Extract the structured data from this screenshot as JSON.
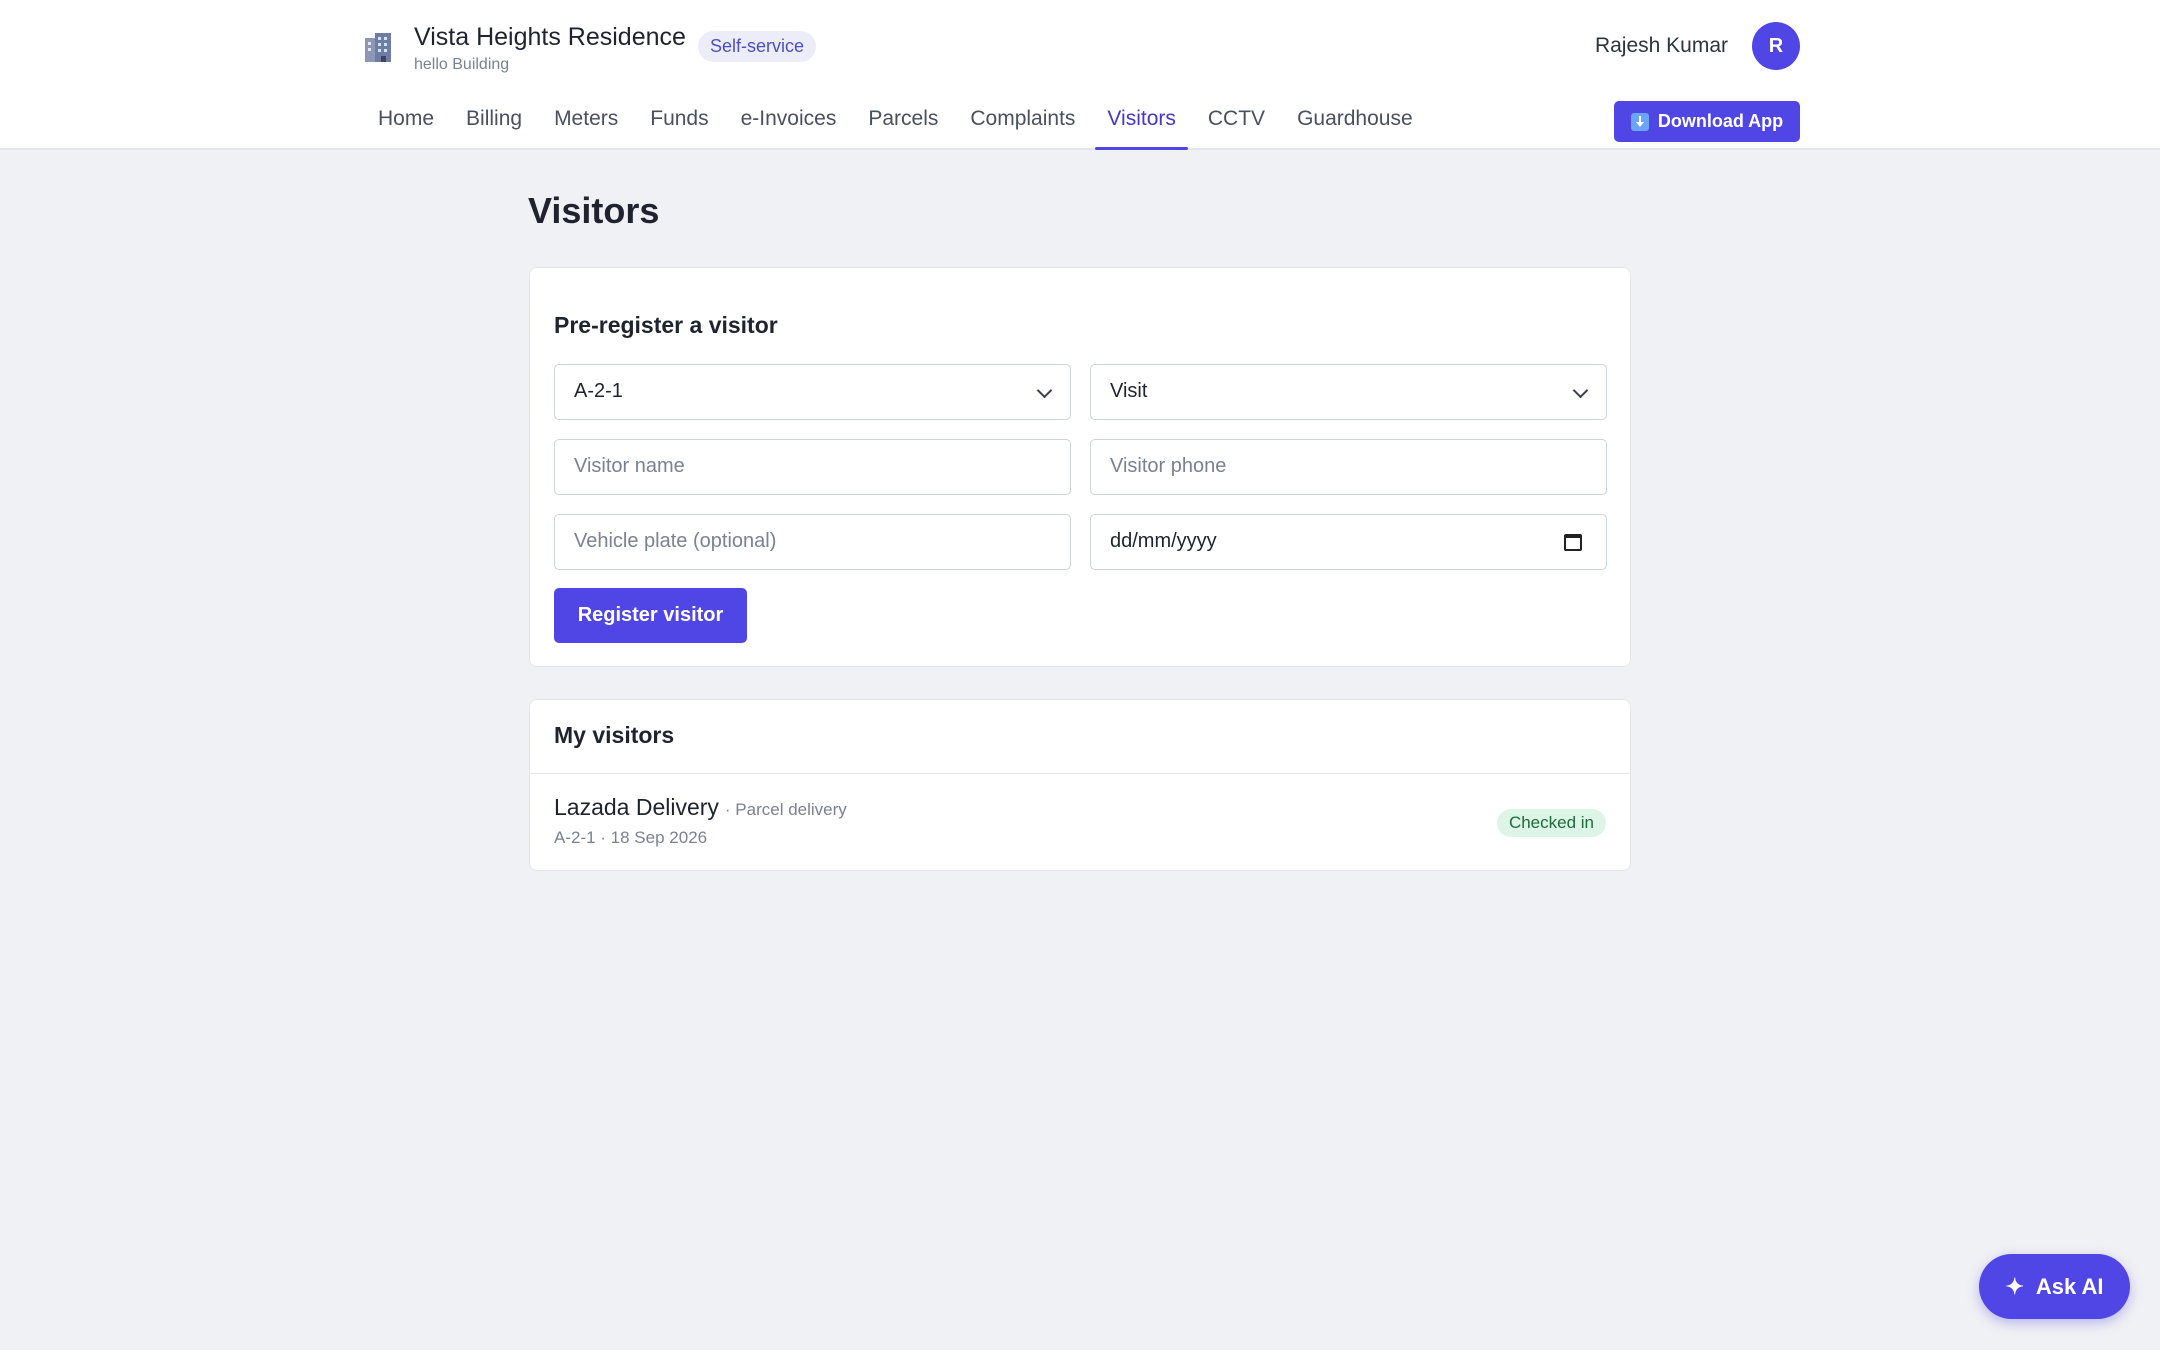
{
  "header": {
    "title": "Vista Heights Residence",
    "subtitle": "hello Building",
    "mode_badge": "Self-service",
    "user_name": "Rajesh Kumar",
    "avatar_initial": "R",
    "download_label": "Download App",
    "brand_icon": "building-icon"
  },
  "nav": {
    "items": [
      {
        "label": "Home"
      },
      {
        "label": "Billing"
      },
      {
        "label": "Meters"
      },
      {
        "label": "Funds"
      },
      {
        "label": "e-Invoices"
      },
      {
        "label": "Parcels"
      },
      {
        "label": "Complaints"
      },
      {
        "label": "Visitors"
      },
      {
        "label": "CCTV"
      },
      {
        "label": "Guardhouse"
      }
    ],
    "active": "Visitors"
  },
  "page": {
    "title": "Visitors"
  },
  "form": {
    "title": "Pre-register a visitor",
    "unit_select_value": "A-2-1",
    "purpose_select_value": "Visit",
    "visitor_name_placeholder": "Visitor name",
    "visitor_phone_placeholder": "Visitor phone",
    "vehicle_plate_placeholder": "Vehicle plate (optional)",
    "date_placeholder": "dd/mm/yyyy",
    "submit_label": "Register visitor"
  },
  "visitors": {
    "title": "My visitors",
    "items": [
      {
        "name": "Lazada Delivery",
        "type": "· Parcel delivery",
        "meta": "A-2-1 · 18 Sep 2026",
        "status": "Checked in"
      }
    ]
  },
  "assistant": {
    "label": "Ask AI",
    "icon": "sparkle-icon"
  },
  "colors": {
    "accent": "#4f46e5",
    "background": "#f0f1f4",
    "status_checked_in_bg": "#dcf5e6",
    "status_checked_in_text": "#1e6b3c"
  }
}
